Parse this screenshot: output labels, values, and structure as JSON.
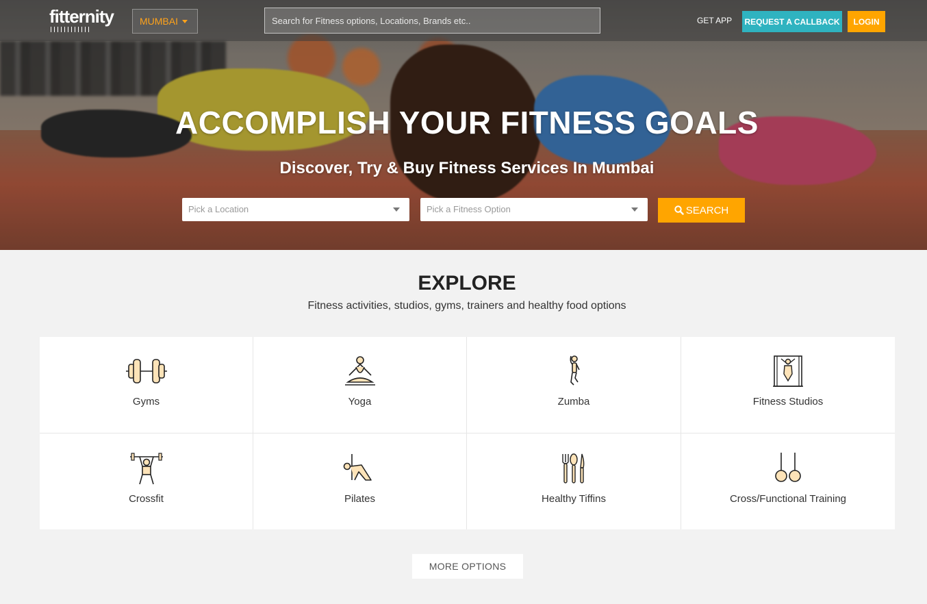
{
  "header": {
    "logo": "fitternity",
    "city": "MUMBAI",
    "search_placeholder": "Search for Fitness options, Locations, Brands etc..",
    "get_app": "GET APP",
    "callback": "REQUEST A CALLBACK",
    "login": "LOGIN"
  },
  "hero": {
    "title": "ACCOMPLISH YOUR FITNESS GOALS",
    "subtitle": "Discover, Try & Buy Fitness Services In Mumbai",
    "location_placeholder": "Pick a Location",
    "option_placeholder": "Pick a Fitness Option",
    "search_button": "SEARCH"
  },
  "explore": {
    "title": "EXPLORE",
    "subtitle": "Fitness activities, studios, gyms, trainers and healthy food options",
    "items": [
      {
        "label": "Gyms",
        "icon": "dumbbell-icon"
      },
      {
        "label": "Yoga",
        "icon": "yoga-icon"
      },
      {
        "label": "Zumba",
        "icon": "zumba-icon"
      },
      {
        "label": "Fitness Studios",
        "icon": "fitness-studio-icon"
      },
      {
        "label": "Crossfit",
        "icon": "crossfit-icon"
      },
      {
        "label": "Pilates",
        "icon": "pilates-icon"
      },
      {
        "label": "Healthy Tiffins",
        "icon": "cutlery-icon"
      },
      {
        "label": "Cross/Functional Training",
        "icon": "gym-rings-icon"
      }
    ],
    "more_button": "MORE OPTIONS"
  },
  "colors": {
    "accent_orange": "#ffa500",
    "accent_teal": "#2fb3c0",
    "icon_fill": "#fde3b8"
  }
}
